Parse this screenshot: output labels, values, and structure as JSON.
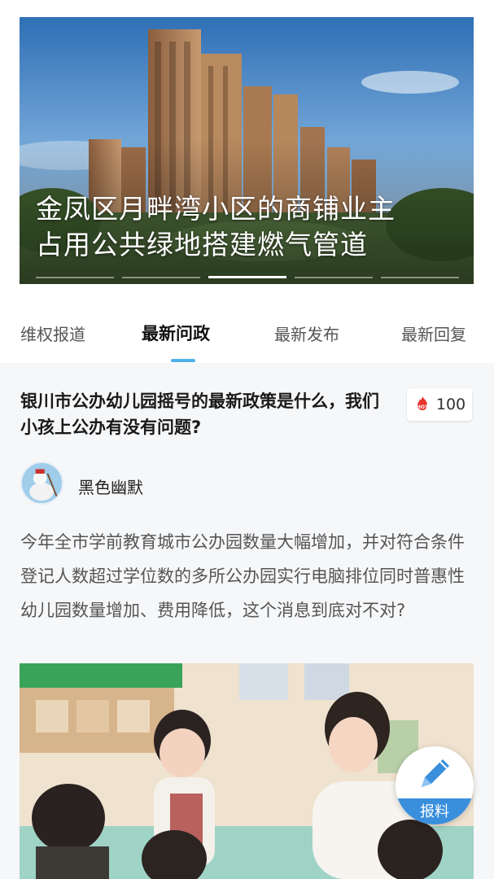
{
  "banner": {
    "title_line1": "金凤区月畔湾小区的商铺业主",
    "title_line2": "占用公共绿地搭建燃气管道",
    "slides": 5,
    "active_slide": 3
  },
  "tabs": [
    {
      "label": "维权报道"
    },
    {
      "label": "最新问政"
    },
    {
      "label": "最新发布"
    },
    {
      "label": "最新回复"
    }
  ],
  "active_tab": 1,
  "question": {
    "title": "银川市公办幼儿园摇号的最新政策是什么，我们小孩上公办有没有问题?",
    "hot_label": "HOT",
    "hot_count": "100",
    "user": "黑色幽默",
    "body": "今年全市学前教育城市公办园数量大幅增加，并对符合条件登记人数超过学位数的多所公办园实行电脑排位同时普惠性幼儿园数量增加、费用降低，这个消息到底对不对?"
  },
  "fab": {
    "label": "报料",
    "icon": "pencil-icon"
  },
  "colors": {
    "accent": "#4fb0e8",
    "fab_blue": "#3a8fdc",
    "hot_red": "#e8332a",
    "content_bg": "#f6f7f9"
  }
}
